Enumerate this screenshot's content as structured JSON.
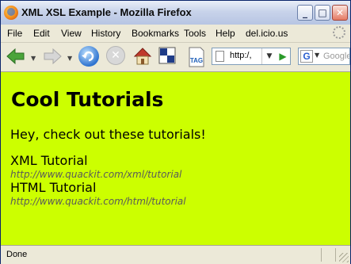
{
  "window": {
    "title": "XML XSL Example - Mozilla Firefox",
    "controls": {
      "minimize": "_",
      "maximize": "□",
      "close": "✕"
    }
  },
  "menubar": {
    "items": [
      "File",
      "Edit",
      "View",
      "History",
      "Bookmarks",
      "Tools",
      "Help",
      "del.icio.us"
    ]
  },
  "toolbar": {
    "address_value": "http:/,",
    "search_placeholder": "Google",
    "search_engine_letter": "G",
    "tag_label": "TAG",
    "go_symbol": "▶",
    "stop_symbol": "✕",
    "dropdown_symbol": "▼",
    "icons": [
      "back-arrow-icon",
      "forward-arrow-icon",
      "reload-icon",
      "stop-icon",
      "home-icon",
      "view-icon",
      "tag-icon",
      "page-icon",
      "google-icon"
    ]
  },
  "page": {
    "background_color": "#ccff00",
    "heading": "Cool Tutorials",
    "intro": "Hey, check out these tutorials!",
    "tutorials": [
      {
        "title": "XML Tutorial",
        "url": "http://www.quackit.com/xml/tutorial"
      },
      {
        "title": "HTML Tutorial",
        "url": "http://www.quackit.com/html/tutorial"
      }
    ]
  },
  "status": {
    "text": "Done"
  }
}
